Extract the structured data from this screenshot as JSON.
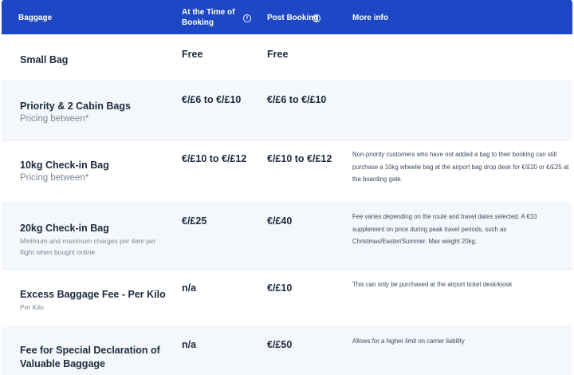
{
  "header": {
    "col_baggage": "Baggage",
    "col_time_of_booking": "At the Time of Booking",
    "col_post_booking": "Post Booking",
    "col_more_info": "More info",
    "info_glyph": "i"
  },
  "rows": [
    {
      "title": "Small Bag",
      "subtitle": "",
      "at_booking": "Free",
      "post_booking": "Free",
      "info": ""
    },
    {
      "title": "Priority & 2 Cabin Bags",
      "subtitle": "Pricing between*",
      "at_booking": "€/£6 to €/£10",
      "post_booking": "€/£6 to €/£10",
      "info": ""
    },
    {
      "title": "10kg Check-in Bag",
      "subtitle": "Pricing between*",
      "at_booking": "€/£10 to €/£12",
      "post_booking": "€/£10 to €/£12",
      "info": "Non-priority customers who have not added a bag to their booking can still purchase a 10kg wheelie bag at the airport bag drop desk for €/£20 or €/£25 at the boarding gate."
    },
    {
      "title": "20kg Check-in Bag",
      "subtitle": "Minimum and maximum charges per item per flight when bought online",
      "at_booking": "€/£25",
      "post_booking": "€/£40",
      "info": "Fee varies depending on the route and travel dates selected. A €10 supplement on price during peak travel periods, such as Christmas/Easter/Summer. Max weight 20kg."
    },
    {
      "title": "Excess Baggage Fee - Per Kilo",
      "subtitle": "Per Kilo",
      "at_booking": "n/a",
      "post_booking": "€/£10",
      "info": "This can only be purchased at the airport ticket desk/kiosk"
    },
    {
      "title": "Fee for Special Declaration of Valuable Baggage",
      "subtitle": "",
      "at_booking": "n/a",
      "post_booking": "€/£50",
      "info": "Allows for a higher limit on carrier liability"
    }
  ],
  "colors": {
    "header_bg": "#1d47c4",
    "alt_row_bg": "#f4f8fc"
  },
  "icons": [
    "info-icon"
  ]
}
